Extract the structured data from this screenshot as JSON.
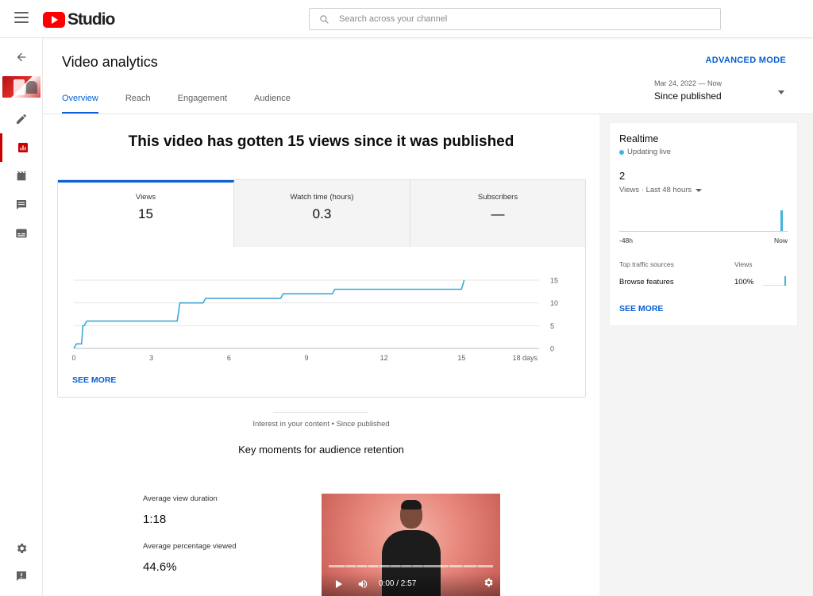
{
  "app": {
    "logo_text": "Studio",
    "search_placeholder": "Search across your channel"
  },
  "header": {
    "title": "Video analytics",
    "advanced_mode": "ADVANCED MODE",
    "tabs": [
      {
        "label": "Overview",
        "active": true
      },
      {
        "label": "Reach",
        "active": false
      },
      {
        "label": "Engagement",
        "active": false
      },
      {
        "label": "Audience",
        "active": false
      }
    ],
    "date_range": {
      "sub": "Mar 24, 2022 — Now",
      "main": "Since published"
    }
  },
  "overview": {
    "headline": "This video has gotten 15 views since it was published",
    "metrics": [
      {
        "label": "Views",
        "value": "15",
        "active": true
      },
      {
        "label": "Watch time (hours)",
        "value": "0.3",
        "active": false
      },
      {
        "label": "Subscribers",
        "value": "—",
        "active": false
      }
    ],
    "see_more": "SEE MORE"
  },
  "chart_data": {
    "type": "line",
    "series": [
      {
        "x": [
          0,
          0.1,
          0.3,
          0.35,
          0.4,
          0.5,
          0.55,
          4.0,
          4.1,
          5.0,
          5.1,
          8.0,
          8.1,
          10.0,
          10.1,
          15.0,
          15.1
        ],
        "y": [
          0,
          1,
          1,
          5,
          5,
          6,
          6,
          6,
          10,
          10,
          11,
          11,
          12,
          12,
          13,
          13,
          15
        ]
      }
    ],
    "x_ticks": [
      0,
      3,
      6,
      9,
      12,
      15
    ],
    "x_tick_labels": [
      "0",
      "3",
      "6",
      "9",
      "12",
      "15",
      "18 days"
    ],
    "y_ticks": [
      0,
      5,
      10,
      15
    ],
    "xlim": [
      0,
      18
    ],
    "ylim": [
      0,
      15
    ],
    "line_color": "#41a7d9"
  },
  "interest": {
    "caption": "Interest in your content • Since published",
    "title": "Key moments for audience retention",
    "avg_view_duration_label": "Average view duration",
    "avg_view_duration": "1:18",
    "avg_pct_label": "Average percentage viewed",
    "avg_pct": "44.6%",
    "video_time": "0:00 / 2:57"
  },
  "realtime": {
    "title": "Realtime",
    "status": "Updating live",
    "count": "2",
    "sub": "Views · Last 48 hours",
    "axis_left": "-48h",
    "axis_right": "Now",
    "traffic_header": "Top traffic sources",
    "views_header": "Views",
    "source": "Browse features",
    "source_pct": "100%",
    "see_more": "SEE MORE",
    "live_color": "#41b4d9"
  },
  "colors": {
    "accent": "#065fd4",
    "brand_red": "#ff0000",
    "nav_active": "#cc0000"
  }
}
